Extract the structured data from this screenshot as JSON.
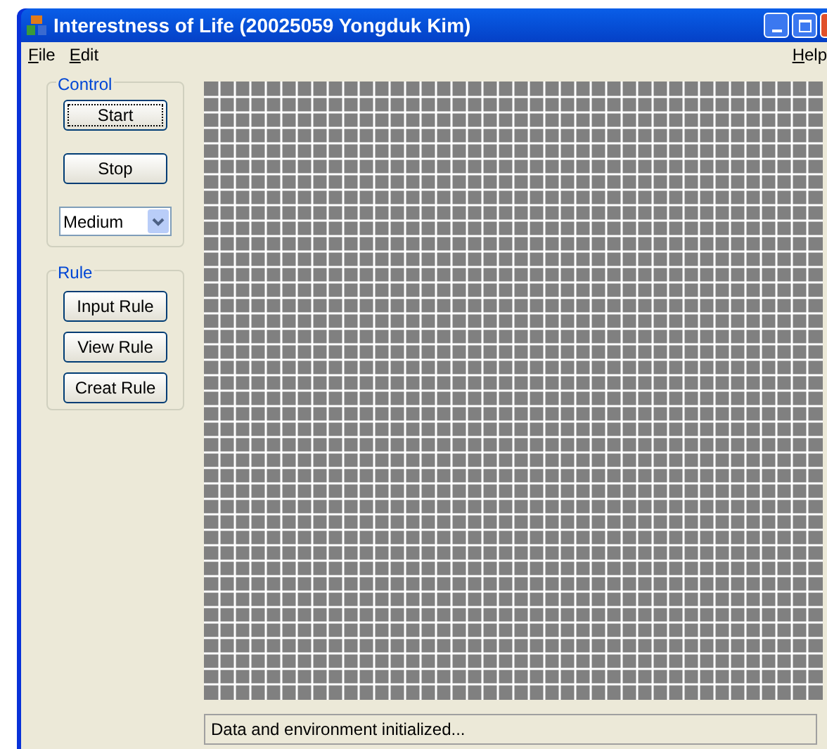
{
  "window": {
    "title": "Interestness of Life (20025059 Yongduk Kim)"
  },
  "menu": [
    {
      "label": "File"
    },
    {
      "label": "Edit"
    },
    {
      "label": "Help"
    }
  ],
  "control": {
    "title": "Control",
    "buttons": [
      {
        "label": "Start",
        "focused": true
      },
      {
        "label": "Stop",
        "focused": false
      }
    ],
    "speed": {
      "value": "Medium"
    }
  },
  "rule": {
    "title": "Rule",
    "buttons": [
      {
        "label": "Input Rule",
        "focused": false
      },
      {
        "label": "View Rule",
        "focused": false
      },
      {
        "label": "Creat Rule",
        "focused": false
      }
    ]
  },
  "status_bar": {
    "text": "Data and environment initialized..."
  }
}
